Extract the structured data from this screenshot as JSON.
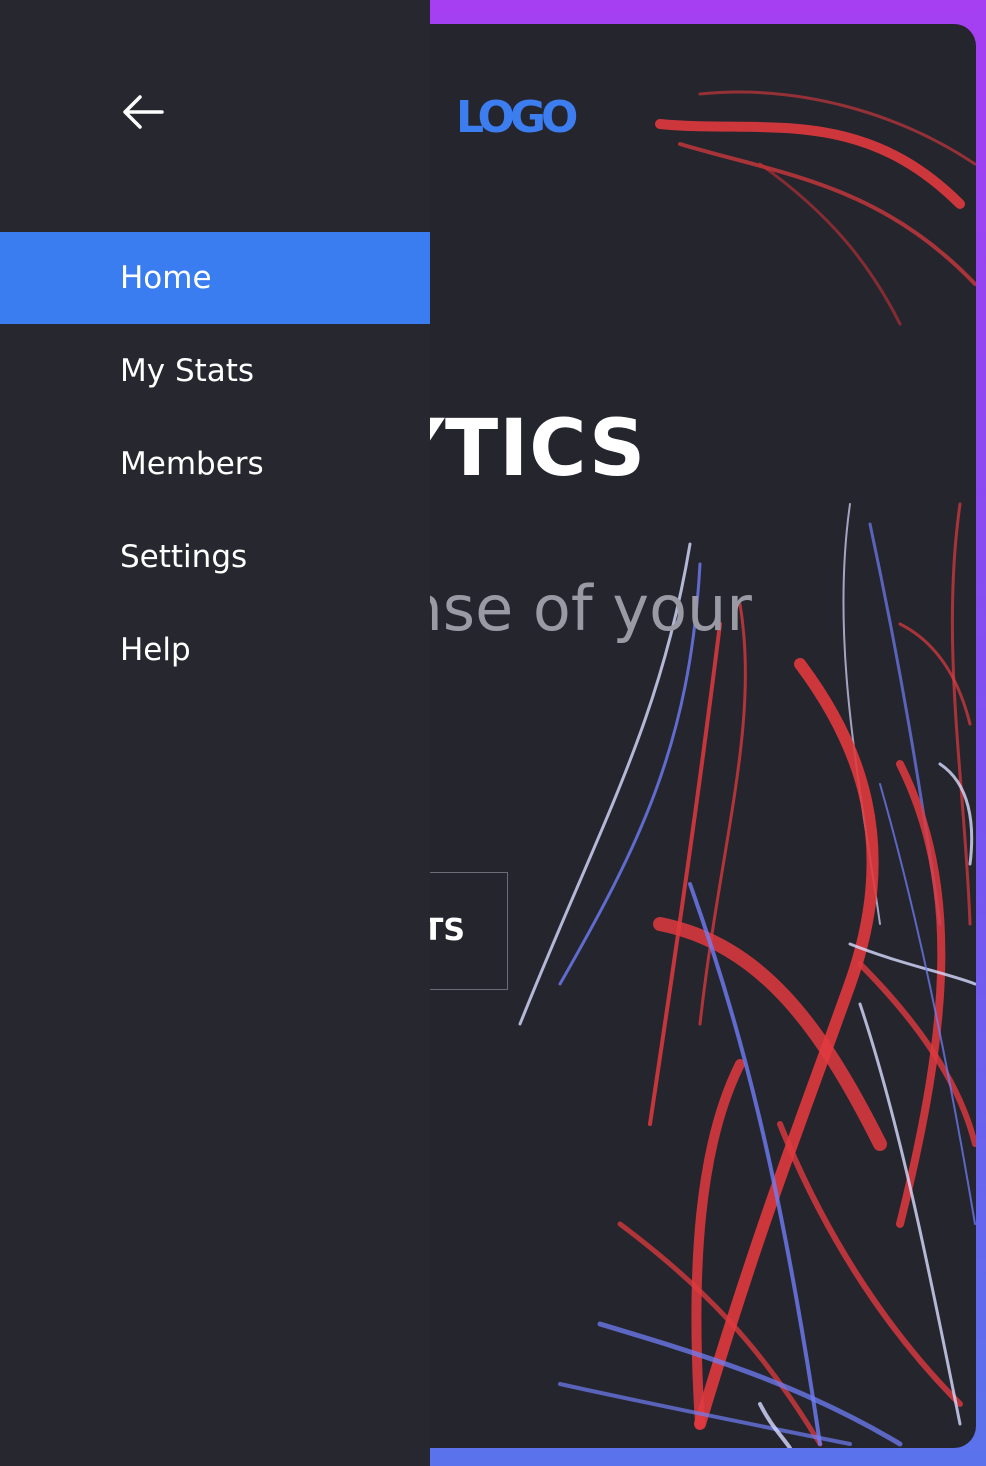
{
  "header": {
    "logo_text": "LOGO"
  },
  "hero": {
    "title": "ANALYTICS",
    "subtitle": "Make sense of your",
    "cta_label": "MY STATS"
  },
  "drawer": {
    "back_icon": "arrow-left-icon",
    "items": [
      {
        "label": "Home",
        "active": true
      },
      {
        "label": "My Stats",
        "active": false
      },
      {
        "label": "Members",
        "active": false
      },
      {
        "label": "Settings",
        "active": false
      },
      {
        "label": "Help",
        "active": false
      }
    ]
  },
  "colors": {
    "accent": "#3a7df0",
    "drawer_bg": "#272730",
    "frame_gradient_top": "#a63ff2",
    "frame_gradient_bottom": "#5a73ec",
    "light_trail_red": "#e03a3e",
    "light_trail_blue": "#6f7df5"
  }
}
